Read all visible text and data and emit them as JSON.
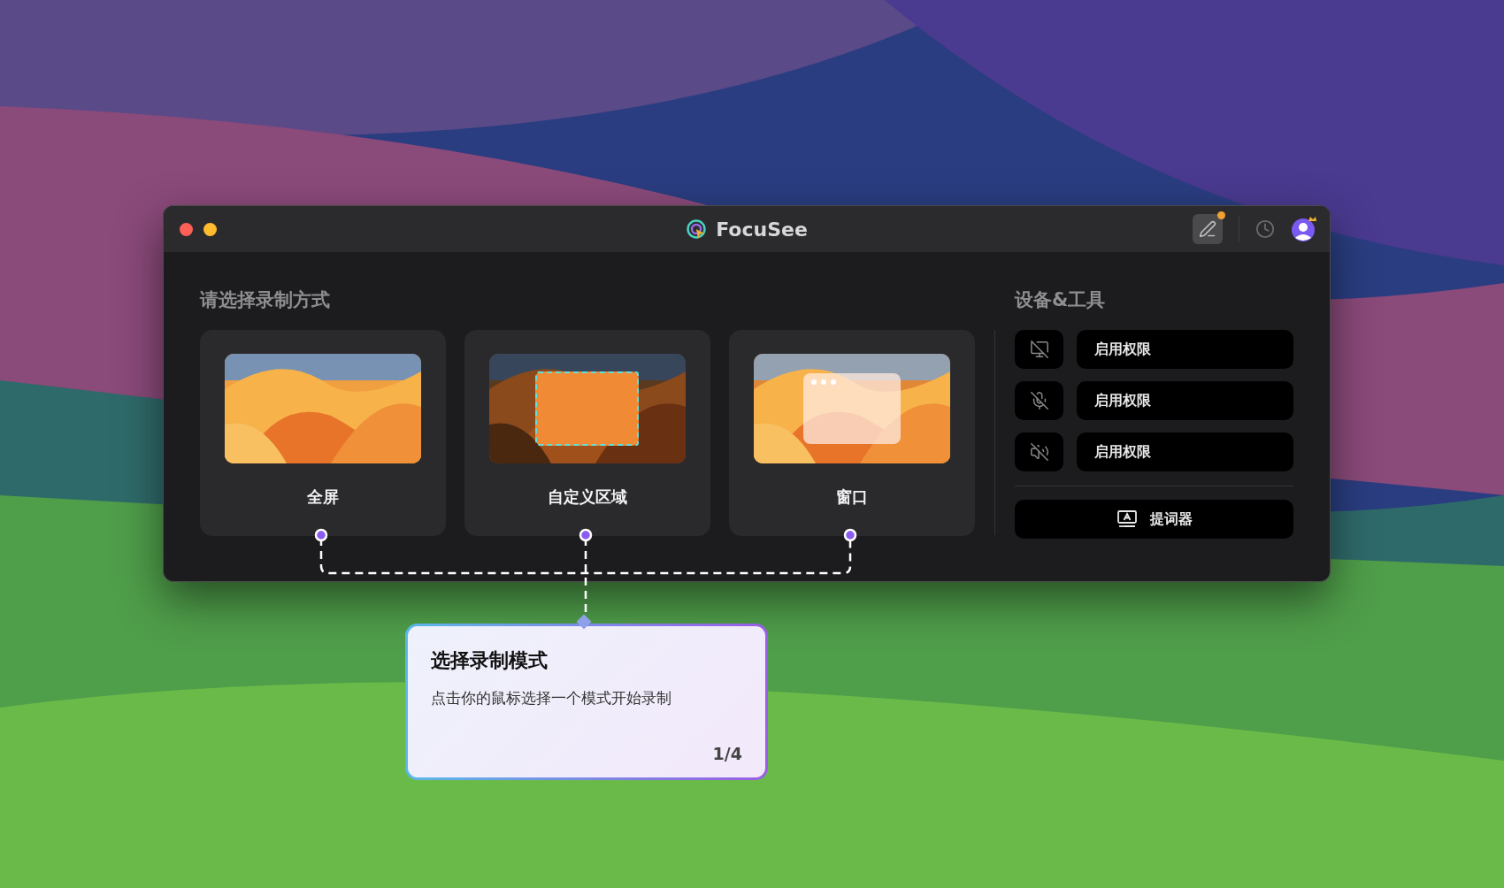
{
  "window": {
    "title": "FocuSee"
  },
  "modes": {
    "heading": "请选择录制方式",
    "items": [
      {
        "kind": "fullscreen",
        "label": "全屏"
      },
      {
        "kind": "region",
        "label": "自定义区域"
      },
      {
        "kind": "window",
        "label": "窗口"
      }
    ]
  },
  "devices": {
    "heading": "设备&工具",
    "items": [
      {
        "kind": "screen",
        "label": "启用权限"
      },
      {
        "kind": "microphone",
        "label": "启用权限"
      },
      {
        "kind": "speaker",
        "label": "启用权限"
      }
    ],
    "teleprompter": "提词器"
  },
  "tooltip": {
    "title": "选择录制模式",
    "body": "点击你的鼠标选择一个模式开始录制",
    "step": "1/4"
  }
}
